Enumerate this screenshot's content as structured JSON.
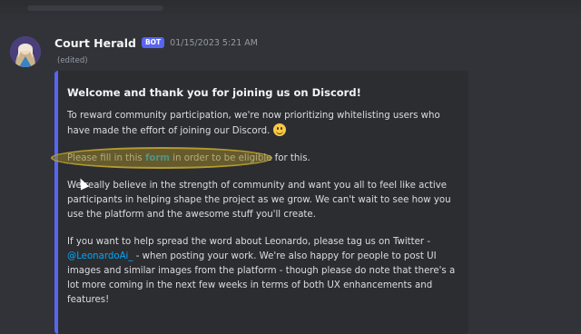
{
  "message": {
    "author": "Court Herald",
    "bot_badge": "BOT",
    "timestamp": "01/15/2023 5:21 AM",
    "edited": "(edited)"
  },
  "embed": {
    "title": "Welcome and thank you for joining us on Discord!",
    "p1": "To reward community participation, we're now prioritizing whitelisting users who have made the effort of joining our Discord.",
    "p2_before": "Please fill in this ",
    "p2_link": "form",
    "p2_after": " in order to be eligible for this.",
    "p3": "We really believe in the strength of community and want you all to feel like active participants in helping shape the project as we grow. We can't wait to see how you use the platform and the awesome stuff you'll create.",
    "p4_before": "If you want to help spread the word about Leonardo, please tag us on Twitter - ",
    "p4_link": "@LeonardoAi_",
    "p4_after": " - when posting your work. We're also happy for people to post UI images and similar images from the platform - though please do note that there's a lot more coming in the next few weeks in terms of both UX enhancements and features!",
    "accent_color": "#5865f2",
    "highlight_color": "#c8aa32"
  },
  "icons": {
    "avatar": "avatar-portrait",
    "emoji": "smiley-emoji",
    "cursor": "mouse-cursor"
  }
}
